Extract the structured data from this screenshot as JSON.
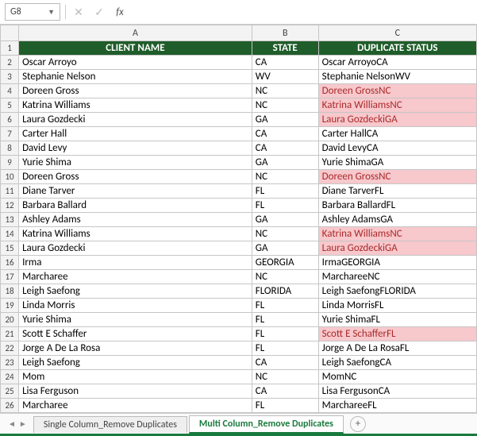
{
  "formula_bar": {
    "name_box": "G8",
    "cancel_icon": "✕",
    "confirm_icon": "✓",
    "fx_label": "fx",
    "formula_value": ""
  },
  "columns": [
    "A",
    "B",
    "C"
  ],
  "header_row_num": "1",
  "headers": {
    "client_name": "CLIENT NAME",
    "state": "STATE",
    "dup_status": "DUPLICATE STATUS"
  },
  "rows": [
    {
      "n": "2",
      "name": "Oscar Arroyo",
      "state": "CA",
      "dup": "Oscar ArroyoCA",
      "flag": false
    },
    {
      "n": "3",
      "name": "Stephanie Nelson",
      "state": "WV",
      "dup": "Stephanie NelsonWV",
      "flag": false
    },
    {
      "n": "4",
      "name": "Doreen Gross",
      "state": "NC",
      "dup": "Doreen GrossNC",
      "flag": true
    },
    {
      "n": "5",
      "name": "Katrina Williams",
      "state": "NC",
      "dup": "Katrina WilliamsNC",
      "flag": true
    },
    {
      "n": "6",
      "name": "Laura Gozdecki",
      "state": "GA",
      "dup": "Laura GozdeckiGA",
      "flag": true
    },
    {
      "n": "7",
      "name": "Carter Hall",
      "state": "CA",
      "dup": "Carter HallCA",
      "flag": false
    },
    {
      "n": "8",
      "name": "David Levy",
      "state": "CA",
      "dup": "David LevyCA",
      "flag": false
    },
    {
      "n": "9",
      "name": "Yurie Shima",
      "state": "GA",
      "dup": "Yurie ShimaGA",
      "flag": false
    },
    {
      "n": "10",
      "name": "Doreen Gross",
      "state": "NC",
      "dup": "Doreen GrossNC",
      "flag": true
    },
    {
      "n": "11",
      "name": "Diane Tarver",
      "state": "FL",
      "dup": "Diane TarverFL",
      "flag": false
    },
    {
      "n": "12",
      "name": "Barbara Ballard",
      "state": "FL",
      "dup": "Barbara BallardFL",
      "flag": false
    },
    {
      "n": "13",
      "name": "Ashley Adams",
      "state": "GA",
      "dup": "Ashley AdamsGA",
      "flag": false
    },
    {
      "n": "14",
      "name": "Katrina Williams",
      "state": "NC",
      "dup": "Katrina WilliamsNC",
      "flag": true
    },
    {
      "n": "15",
      "name": "Laura Gozdecki",
      "state": "GA",
      "dup": "Laura GozdeckiGA",
      "flag": true
    },
    {
      "n": "16",
      "name": "Irma",
      "state": "GEORGIA",
      "dup": "IrmaGEORGIA",
      "flag": false
    },
    {
      "n": "17",
      "name": "Marcharee",
      "state": "NC",
      "dup": "MarchareeNC",
      "flag": false
    },
    {
      "n": "18",
      "name": "Leigh Saefong",
      "state": "FLORIDA",
      "dup": "Leigh SaefongFLORIDA",
      "flag": false
    },
    {
      "n": "19",
      "name": "Linda Morris",
      "state": "FL",
      "dup": "Linda MorrisFL",
      "flag": false
    },
    {
      "n": "20",
      "name": "Yurie Shima",
      "state": "FL",
      "dup": "Yurie ShimaFL",
      "flag": false
    },
    {
      "n": "21",
      "name": "Scott E Schaffer",
      "state": "FL",
      "dup": "Scott E SchafferFL",
      "flag": true
    },
    {
      "n": "22",
      "name": "Jorge A De La Rosa",
      "state": "FL",
      "dup": "Jorge A De La RosaFL",
      "flag": false
    },
    {
      "n": "23",
      "name": "Leigh Saefong",
      "state": "CA",
      "dup": "Leigh SaefongCA",
      "flag": false
    },
    {
      "n": "24",
      "name": "Mom",
      "state": "NC",
      "dup": "MomNC",
      "flag": false
    },
    {
      "n": "25",
      "name": "Lisa Ferguson",
      "state": "CA",
      "dup": "Lisa FergusonCA",
      "flag": false
    },
    {
      "n": "26",
      "name": "Marcharee",
      "state": "FL",
      "dup": "MarchareeFL",
      "flag": false
    }
  ],
  "active_row": "8",
  "tabs": {
    "tab1": "Single Column_Remove Duplicates",
    "tab2": "Multi Column_Remove Duplicates",
    "add_label": "+"
  }
}
